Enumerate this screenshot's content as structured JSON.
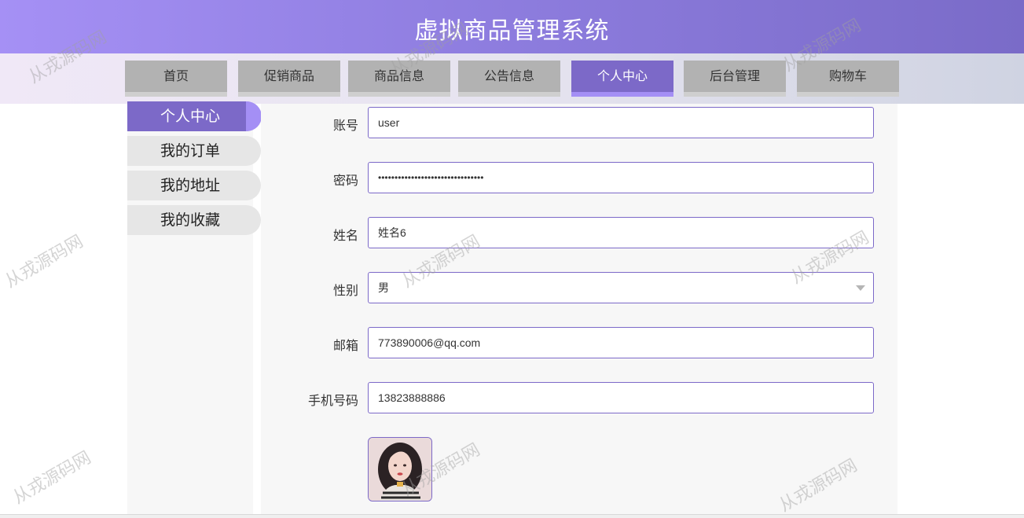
{
  "header": {
    "title": "虚拟商品管理系统"
  },
  "nav": {
    "items": [
      {
        "label": "首页"
      },
      {
        "label": "促销商品"
      },
      {
        "label": "商品信息"
      },
      {
        "label": "公告信息"
      },
      {
        "label": "个人中心"
      },
      {
        "label": "后台管理"
      },
      {
        "label": "购物车"
      }
    ],
    "active": "个人中心"
  },
  "sidebar": {
    "items": [
      {
        "label": "个人中心"
      },
      {
        "label": "我的订单"
      },
      {
        "label": "我的地址"
      },
      {
        "label": "我的收藏"
      }
    ],
    "active": "个人中心"
  },
  "form": {
    "account": {
      "label": "账号",
      "value": "user"
    },
    "password": {
      "label": "密码",
      "value": "••••••••••••••••••••••••••••••••"
    },
    "name": {
      "label": "姓名",
      "value": "姓名6"
    },
    "gender": {
      "label": "性别",
      "value": "男"
    },
    "email": {
      "label": "邮箱",
      "value": "773890006@qq.com"
    },
    "phone": {
      "label": "手机号码",
      "value": "13823888886"
    }
  },
  "watermark": {
    "text": "从戎源码网"
  },
  "colors": {
    "accent": "#7c69c8",
    "accent_light": "#a48ff5",
    "nav_inactive": "#b2b2b2"
  }
}
